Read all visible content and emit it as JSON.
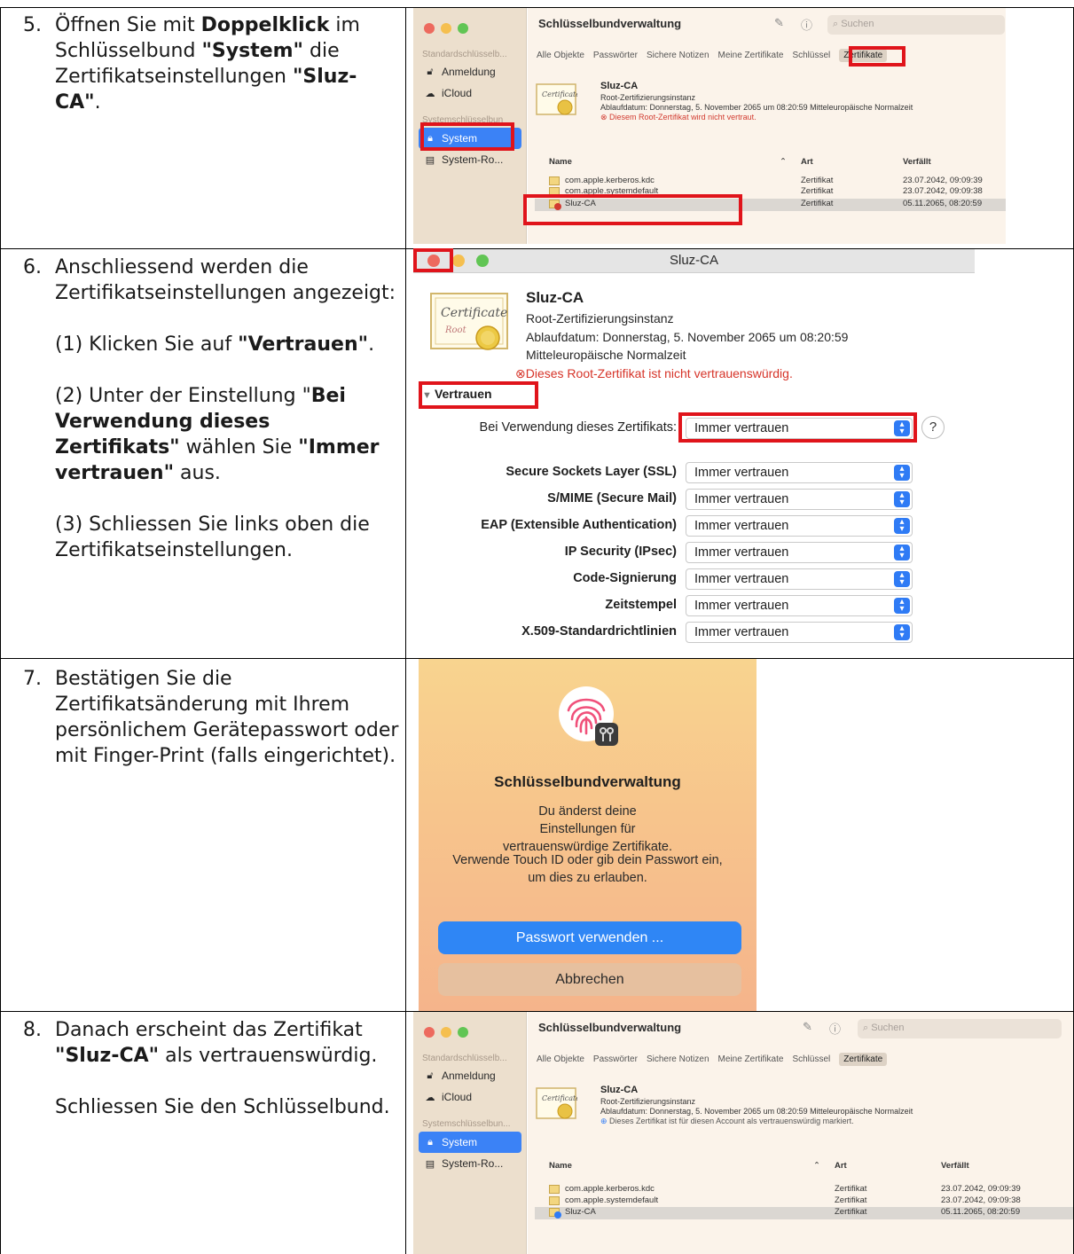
{
  "steps": [
    {
      "num": "5.",
      "paragraphs": [
        [
          {
            "t": "Öffnen Sie mit ",
            "b": false
          },
          {
            "t": "Doppelklick",
            "b": true
          },
          {
            "t": " im Schlüsselbund ",
            "b": false
          },
          {
            "t": "\"System\"",
            "b": true
          },
          {
            "t": " die Zertifikatseinstellungen ",
            "b": false
          },
          {
            "t": "\"Sluz-CA\"",
            "b": true
          },
          {
            "t": ".",
            "b": false
          }
        ]
      ]
    },
    {
      "num": "6.",
      "paragraphs": [
        [
          {
            "t": "Anschliessend werden die Zertifikatseinstellungen angezeigt:",
            "b": false
          }
        ],
        [
          {
            "t": "(1) Klicken Sie auf ",
            "b": false
          },
          {
            "t": "\"Vertrauen\"",
            "b": true
          },
          {
            "t": ".",
            "b": false
          }
        ],
        [
          {
            "t": "(2) Unter der Einstellung \"",
            "b": false
          },
          {
            "t": "Bei Verwendung dieses Zertifikats\"",
            "b": true
          },
          {
            "t": " wählen Sie ",
            "b": false
          },
          {
            "t": "\"Immer vertrauen\"",
            "b": true
          },
          {
            "t": " aus.",
            "b": false
          }
        ],
        [
          {
            "t": "(3) Schliessen Sie links oben die Zertifikatseinstellungen.",
            "b": false
          }
        ]
      ]
    },
    {
      "num": "7.",
      "paragraphs": [
        [
          {
            "t": "Bestätigen Sie die Zertifikatsänderung mit Ihrem persönlichem Gerätepasswort oder mit Finger-Print (falls eingerichtet).",
            "b": false
          }
        ]
      ]
    },
    {
      "num": "8.",
      "paragraphs": [
        [
          {
            "t": "Danach erscheint das Zertifikat ",
            "b": false
          },
          {
            "t": "\"Sluz-CA\"",
            "b": true
          },
          {
            "t": " als vertrauenswürdig.",
            "b": false
          }
        ],
        [
          {
            "t": "Schliessen Sie den Schlüsselbund.",
            "b": false
          }
        ]
      ]
    }
  ],
  "keychain": {
    "title": "Schlüsselbundverwaltung",
    "search_placeholder": "Suchen",
    "sidebar": {
      "section1": "Standardschlüsselb...",
      "section1_b": "Standardschlüsselb...",
      "section2": "Systemschlüsselbun...",
      "section2_a": "Systemschlüsselbun",
      "items": [
        "Anmeldung",
        "iCloud",
        "System",
        "System-Ro..."
      ]
    },
    "tabs": [
      "Alle Objekte",
      "Passwörter",
      "Sichere Notizen",
      "Meine Zertifikate",
      "Schlüssel",
      "Zertifikate"
    ],
    "cert_title": "Sluz-CA",
    "cert_kind": "Root-Zertifizierungsinstanz",
    "cert_expiry": "Ablaufdatum: Donnerstag, 5. November 2065 um 08:20:59 Mitteleuropäische Normalzeit",
    "status_untrusted": "Diesem Root-Zertifikat wird nicht vertraut.",
    "status_trusted": "Dieses Zertifikat ist für diesen Account als vertrauenswürdig markiert.",
    "columns": [
      "Name",
      "Art",
      "Verfällt"
    ],
    "rows": [
      {
        "name": "com.apple.kerberos.kdc",
        "kind": "Zertifikat",
        "expires": "23.07.2042, 09:09:39"
      },
      {
        "name": "com.apple.systemdefault",
        "kind": "Zertifikat",
        "expires": "23.07.2042, 09:09:38"
      },
      {
        "name": "Sluz-CA",
        "kind": "Zertifikat",
        "expires": "05.11.2065, 08:20:59"
      }
    ]
  },
  "cert_window": {
    "title": "Sluz-CA",
    "cert_title": "Sluz-CA",
    "cert_kind": "Root-Zertifizierungsinstanz",
    "expiry_line1": "Ablaufdatum: Donnerstag, 5. November 2065 um 08:20:59",
    "expiry_line2": "Mitteleuropäische Normalzeit",
    "status": "Dieses Root-Zertifikat ist nicht vertrauenswürdig.",
    "section": "Vertrauen",
    "main_label": "Bei Verwendung dieses Zertifikats:",
    "main_value": "Immer vertrauen",
    "settings": [
      {
        "label": "Secure Sockets Layer (SSL)",
        "value": "Immer vertrauen"
      },
      {
        "label": "S/MIME (Secure Mail)",
        "value": "Immer vertrauen"
      },
      {
        "label": "EAP (Extensible Authentication)",
        "value": "Immer vertrauen"
      },
      {
        "label": "IP Security (IPsec)",
        "value": "Immer vertrauen"
      },
      {
        "label": "Code-Signierung",
        "value": "Immer vertrauen"
      },
      {
        "label": "Zeitstempel",
        "value": "Immer vertrauen"
      },
      {
        "label": "X.509-Standardrichtlinien",
        "value": "Immer vertrauen"
      }
    ],
    "help": "?"
  },
  "auth_dialog": {
    "title": "Schlüsselbundverwaltung",
    "message1": "Du änderst deine Einstellungen für vertrauenswürdige Zertifikate.",
    "message2": "Verwende Touch ID oder gib dein Passwort ein, um dies zu erlauben.",
    "primary": "Passwort verwenden ...",
    "secondary": "Abbrechen"
  },
  "colors": {
    "highlight": "#e0141b",
    "accent": "#2f7bf5",
    "close": "#ed6a5e",
    "minimize": "#f5bf4f",
    "zoom": "#61c554"
  }
}
